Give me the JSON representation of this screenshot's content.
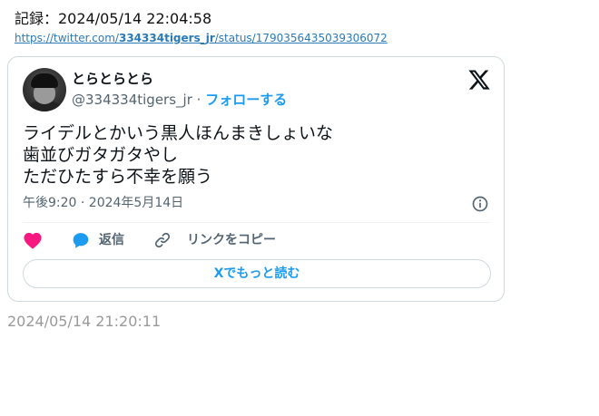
{
  "record": {
    "label": "記録：2024/05/14 22:04:58",
    "link_prefix": "https://twitter.com/",
    "link_user": "334334tigers_jr",
    "link_suffix": "/status/1790356435039306072"
  },
  "tweet": {
    "author_name": "とらとらとら",
    "author_handle": "@334334tigers_jr",
    "separator": " · ",
    "follow_label": "フォローする",
    "text_lines": [
      "ライデルとかいう黒人ほんまきしょいな",
      "歯並びガタガタやし",
      "ただひたすら不幸を願う"
    ],
    "timestamp": "午後9:20 · 2024年5月14日",
    "reply_label": "返信",
    "copy_link_label": "リンクをコピー",
    "read_more_label": "Xでもっと読む"
  },
  "saved_time": "2024/05/14 21:20:11",
  "colors": {
    "accent": "#1d9bf0",
    "like": "#f91880",
    "muted": "#536471"
  },
  "icons": {
    "brand": "x-logo-icon",
    "like": "heart-icon",
    "reply": "reply-bubble-icon",
    "copy": "link-icon",
    "info": "info-icon"
  }
}
